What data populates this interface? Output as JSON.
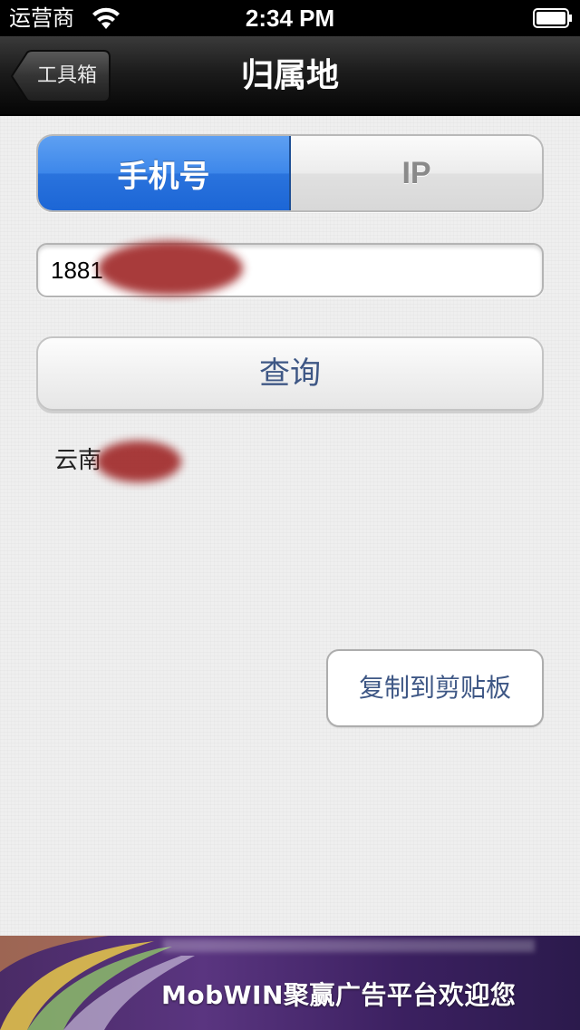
{
  "status_bar": {
    "carrier": "运营商",
    "time": "2:34 PM",
    "wifi_icon": "wifi-icon",
    "battery_icon": "battery-icon"
  },
  "nav": {
    "back_label": "工具箱",
    "title": "归属地"
  },
  "segments": [
    {
      "label": "手机号",
      "selected": true
    },
    {
      "label": "IP",
      "selected": false
    }
  ],
  "phone_input": {
    "value": "1881"
  },
  "query_button": {
    "label": "查询"
  },
  "result": {
    "text": "云南"
  },
  "copy_button": {
    "label": "复制到剪贴板"
  },
  "ad": {
    "text": "MobWIN聚赢广告平台欢迎您"
  },
  "colors": {
    "segment_active": "#2a73dd",
    "button_text": "#3e5785",
    "nav_bar": "#1c1c1c",
    "redaction": "#a12b2b"
  }
}
